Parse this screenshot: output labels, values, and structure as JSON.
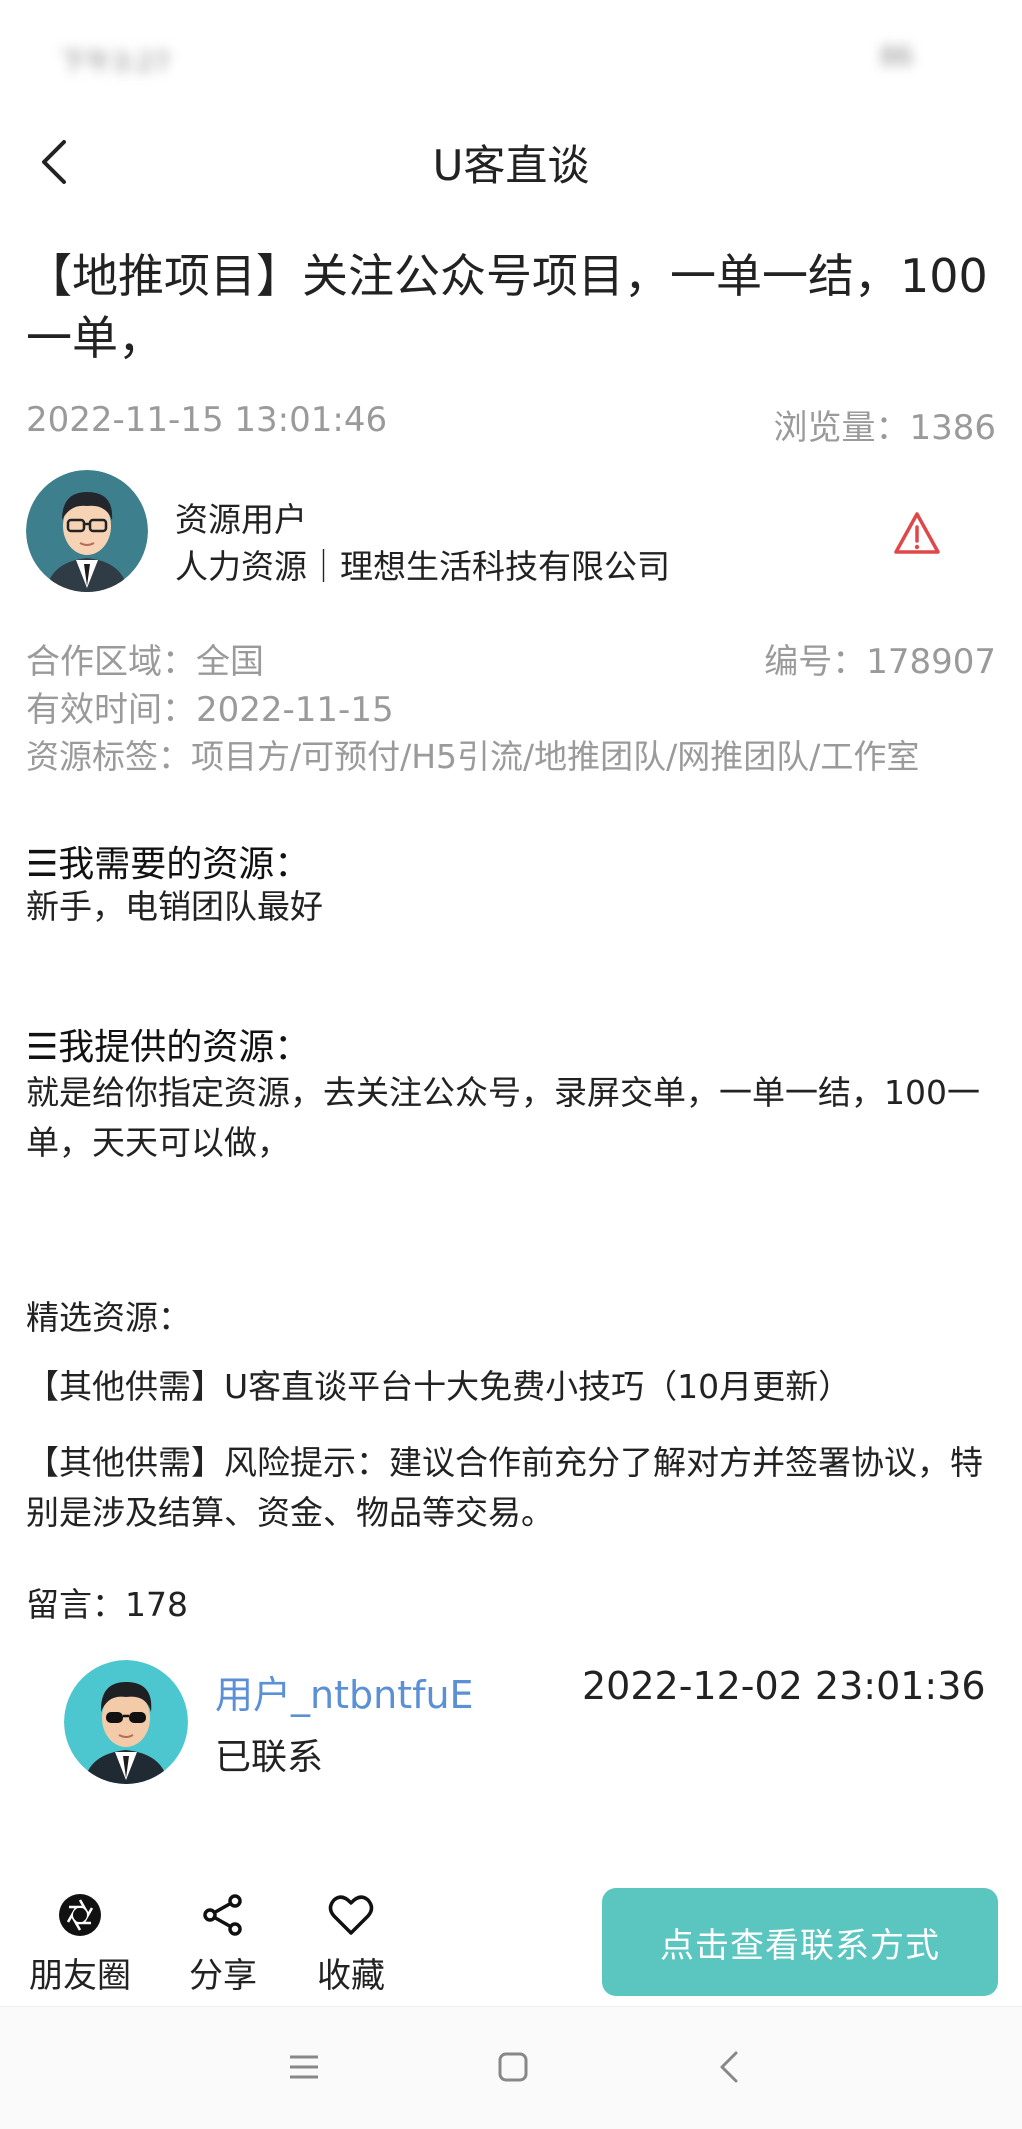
{
  "status_bar": {
    "time": "下午3:27",
    "battery": "86"
  },
  "header": {
    "title": "U客直谈"
  },
  "post": {
    "title": "【地推项目】关注公众号项目，一单一结，100一单，",
    "datetime": "2022-11-15 13:01:46",
    "views": "浏览量：1386"
  },
  "author": {
    "name": "资源用户",
    "org": "人力资源｜理想生活科技有限公司"
  },
  "info": {
    "region": "合作区域：全国",
    "serial": "编号：178907",
    "valid": "有效时间：2022-11-15",
    "tags": "资源标签：项目方/可预付/H5引流/地推团队/网推团队/工作室"
  },
  "need": {
    "heading": "我需要的资源：",
    "body": "新手，电销团队最好"
  },
  "offer": {
    "heading": "我提供的资源：",
    "body": "就是给你指定资源，去关注公众号，录屏交单，一单一结，100一单，天天可以做，"
  },
  "featured": {
    "heading": "精选资源：",
    "items": [
      "【其他供需】U客直谈平台十大免费小技巧（10月更新）",
      "【其他供需】风险提示：建议合作前充分了解对方并签署协议，特别是涉及结算、资金、物品等交易。"
    ]
  },
  "comments": {
    "count_label": "留言：178",
    "items": [
      {
        "user": "用户_ntbntfuE",
        "time": "2022-12-02 23:01:36",
        "text": "已联系"
      }
    ]
  },
  "bottom_bar": {
    "moments": "朋友圈",
    "share": "分享",
    "favorite": "收藏",
    "contact": "点击查看联系方式"
  },
  "colors": {
    "accent": "#5bc5bf",
    "warning": "#e04848",
    "link": "#5b8fd6",
    "muted": "#9a9a9a"
  }
}
